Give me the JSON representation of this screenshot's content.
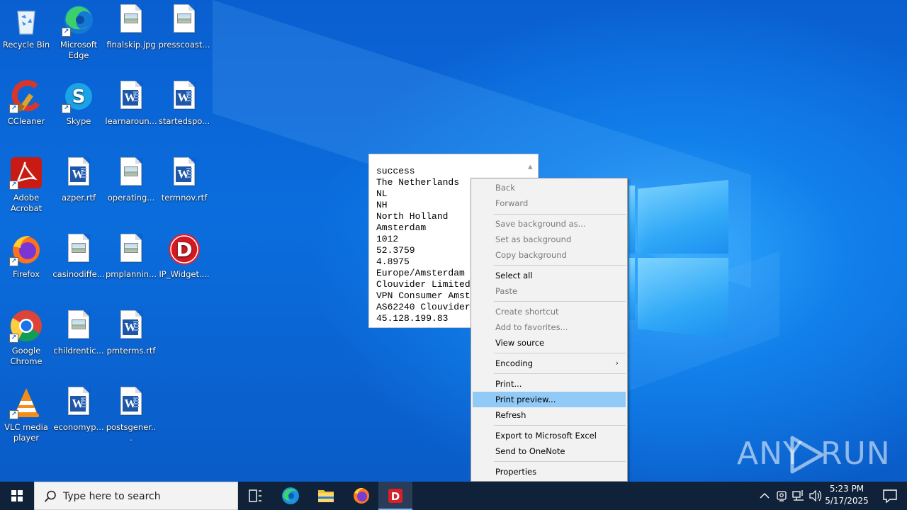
{
  "desktop": {
    "icons": [
      {
        "label": "Recycle Bin",
        "type": "recycle"
      },
      {
        "label": "Microsoft Edge",
        "type": "edge"
      },
      {
        "label": "finalskip.jpg",
        "type": "image"
      },
      {
        "label": "presscoast...",
        "type": "image"
      },
      {
        "label": "CCleaner",
        "type": "ccleaner"
      },
      {
        "label": "Skype",
        "type": "skype"
      },
      {
        "label": "learnaroun...",
        "type": "word"
      },
      {
        "label": "startedspo...",
        "type": "word"
      },
      {
        "label": "Adobe Acrobat",
        "type": "acrobat"
      },
      {
        "label": "azper.rtf",
        "type": "word"
      },
      {
        "label": "operating...",
        "type": "image"
      },
      {
        "label": "termnov.rtf",
        "type": "word"
      },
      {
        "label": "Firefox",
        "type": "firefox"
      },
      {
        "label": "casinodiffe...",
        "type": "image"
      },
      {
        "label": "pmplannin...",
        "type": "image"
      },
      {
        "label": "IP_Widget....",
        "type": "ipwidget"
      },
      {
        "label": "Google Chrome",
        "type": "chrome"
      },
      {
        "label": "childrentic...",
        "type": "image"
      },
      {
        "label": "pmterms.rtf",
        "type": "word"
      },
      {
        "label": "VLC media player",
        "type": "vlc"
      },
      {
        "label": "economyp...",
        "type": "word"
      },
      {
        "label": "postsgener...",
        "type": "word"
      }
    ]
  },
  "textbox": {
    "lines": [
      "success",
      "The Netherlands",
      "NL",
      "NH",
      "North Holland",
      "Amsterdam",
      "1012",
      "52.3759",
      "4.8975",
      "Europe/Amsterdam",
      "Clouvider Limited",
      "VPN Consumer Amst",
      "AS62240 Clouvider",
      "45.128.199.83"
    ]
  },
  "context_menu": {
    "items": [
      {
        "label": "Back",
        "enabled": false
      },
      {
        "label": "Forward",
        "enabled": false
      },
      {
        "label": "Save background as...",
        "enabled": false
      },
      {
        "label": "Set as background",
        "enabled": false
      },
      {
        "label": "Copy background",
        "enabled": false
      },
      {
        "label": "Select all",
        "enabled": true
      },
      {
        "label": "Paste",
        "enabled": false
      },
      {
        "label": "Create shortcut",
        "enabled": false
      },
      {
        "label": "Add to favorites...",
        "enabled": false
      },
      {
        "label": "View source",
        "enabled": true
      },
      {
        "label": "Encoding",
        "enabled": true,
        "submenu": true
      },
      {
        "label": "Print...",
        "enabled": true
      },
      {
        "label": "Print preview...",
        "enabled": true,
        "highlighted": true
      },
      {
        "label": "Refresh",
        "enabled": true
      },
      {
        "label": "Export to Microsoft Excel",
        "enabled": true
      },
      {
        "label": "Send to OneNote",
        "enabled": true
      },
      {
        "label": "Properties",
        "enabled": true
      }
    ]
  },
  "watermark": {
    "left": "ANY",
    "right": "RUN"
  },
  "taskbar": {
    "search_placeholder": "Type here to search",
    "clock_time": "5:23 PM",
    "clock_date": "5/17/2025"
  },
  "colors": {
    "desktop_blue": "#0a64d6",
    "taskbar": "#10213a",
    "menu_highlight": "#91c9f7"
  }
}
